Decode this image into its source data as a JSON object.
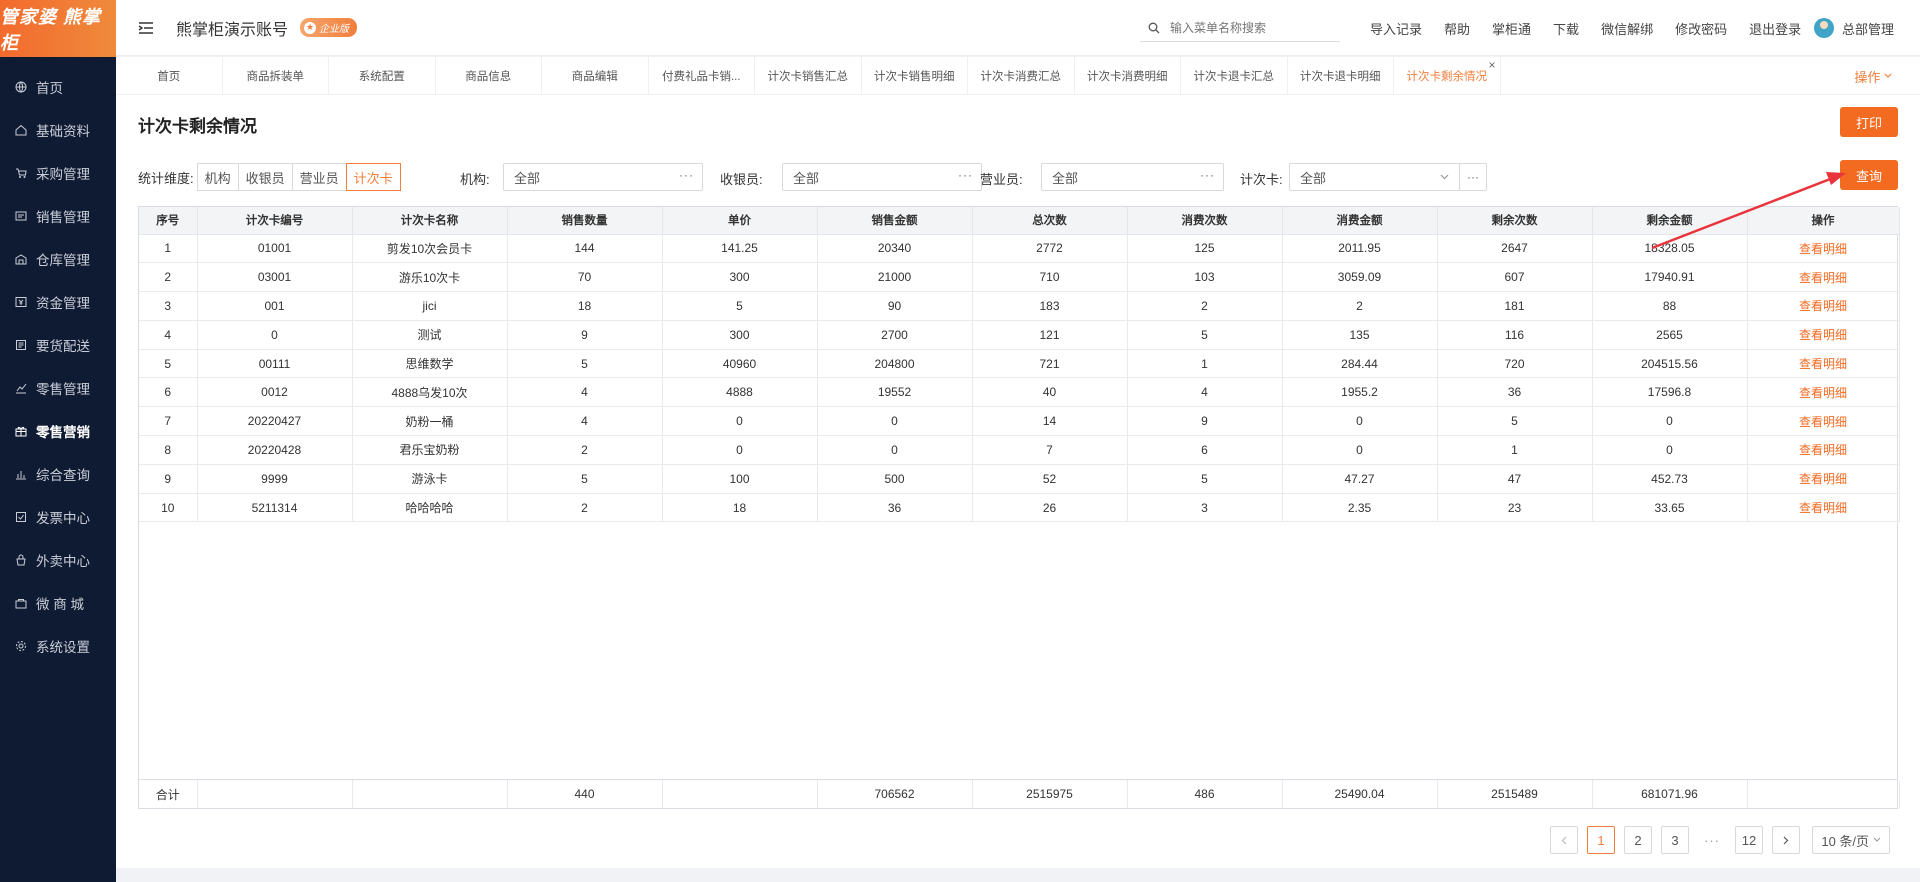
{
  "app": {
    "logo": "管家婆 熊掌柜",
    "account": "熊掌柜演示账号",
    "badge": "企业版"
  },
  "sidebar": {
    "items": [
      {
        "label": "首页",
        "icon": "globe-icon"
      },
      {
        "label": "基础资料",
        "icon": "home-icon"
      },
      {
        "label": "采购管理",
        "icon": "cart-icon"
      },
      {
        "label": "销售管理",
        "icon": "sale-icon"
      },
      {
        "label": "仓库管理",
        "icon": "warehouse-icon"
      },
      {
        "label": "资金管理",
        "icon": "money-icon"
      },
      {
        "label": "要货配送",
        "icon": "delivery-icon"
      },
      {
        "label": "零售管理",
        "icon": "chart-icon"
      },
      {
        "label": "零售营销",
        "icon": "gift-icon"
      },
      {
        "label": "综合查询",
        "icon": "bar-icon"
      },
      {
        "label": "发票中心",
        "icon": "invoice-icon"
      },
      {
        "label": "外卖中心",
        "icon": "takeout-icon"
      },
      {
        "label": "微 商 城",
        "icon": "shop-icon"
      },
      {
        "label": "系统设置",
        "icon": "gear-icon"
      }
    ]
  },
  "header": {
    "search_placeholder": "输入菜单名称搜索",
    "links": [
      "导入记录",
      "帮助",
      "掌柜通",
      "下载",
      "微信解绑",
      "修改密码",
      "退出登录"
    ],
    "user": "总部管理"
  },
  "tabs": {
    "items": [
      "首页",
      "商品拆装单",
      "系统配置",
      "商品信息",
      "商品编辑",
      "付费礼品卡销...",
      "计次卡销售汇总",
      "计次卡销售明细",
      "计次卡消费汇总",
      "计次卡消费明细",
      "计次卡退卡汇总",
      "计次卡退卡明细",
      "计次卡剩余情况"
    ],
    "ops": "操作"
  },
  "page": {
    "title": "计次卡剩余情况",
    "print": "打印",
    "query": "查询",
    "dimension_label": "统计维度:",
    "dimensions": [
      "机构",
      "收银员",
      "营业员",
      "计次卡"
    ],
    "org_label": "机构:",
    "org_value": "全部",
    "cashier_label": "收银员:",
    "cashier_value": "全部",
    "sales_label": "营业员:",
    "sales_value": "全部",
    "card_label": "计次卡:",
    "card_value": "全部"
  },
  "table": {
    "headers": [
      "序号",
      "计次卡编号",
      "计次卡名称",
      "销售数量",
      "单价",
      "销售金额",
      "总次数",
      "消费次数",
      "消费金额",
      "剩余次数",
      "剩余金额",
      "操作"
    ],
    "rows": [
      [
        "1",
        "01001",
        "剪发10次会员卡",
        "144",
        "141.25",
        "20340",
        "2772",
        "125",
        "2011.95",
        "2647",
        "18328.05",
        "查看明细"
      ],
      [
        "2",
        "03001",
        "游乐10次卡",
        "70",
        "300",
        "21000",
        "710",
        "103",
        "3059.09",
        "607",
        "17940.91",
        "查看明细"
      ],
      [
        "3",
        "001",
        "jici",
        "18",
        "5",
        "90",
        "183",
        "2",
        "2",
        "181",
        "88",
        "查看明细"
      ],
      [
        "4",
        "0",
        "测试",
        "9",
        "300",
        "2700",
        "121",
        "5",
        "135",
        "116",
        "2565",
        "查看明细"
      ],
      [
        "5",
        "00111",
        "思维数学",
        "5",
        "40960",
        "204800",
        "721",
        "1",
        "284.44",
        "720",
        "204515.56",
        "查看明细"
      ],
      [
        "6",
        "0012",
        "4888乌发10次",
        "4",
        "4888",
        "19552",
        "40",
        "4",
        "1955.2",
        "36",
        "17596.8",
        "查看明细"
      ],
      [
        "7",
        "20220427",
        "奶粉一桶",
        "4",
        "0",
        "0",
        "14",
        "9",
        "0",
        "5",
        "0",
        "查看明细"
      ],
      [
        "8",
        "20220428",
        "君乐宝奶粉",
        "2",
        "0",
        "0",
        "7",
        "6",
        "0",
        "1",
        "0",
        "查看明细"
      ],
      [
        "9",
        "9999",
        "游泳卡",
        "5",
        "100",
        "500",
        "52",
        "5",
        "47.27",
        "47",
        "452.73",
        "查看明细"
      ],
      [
        "10",
        "5211314",
        "哈哈哈哈",
        "2",
        "18",
        "36",
        "26",
        "3",
        "2.35",
        "23",
        "33.65",
        "查看明细"
      ]
    ],
    "total": [
      "合计",
      "",
      "",
      "440",
      "",
      "706562",
      "2515975",
      "486",
      "25490.04",
      "2515489",
      "681071.96",
      ""
    ]
  },
  "pager": {
    "pages": [
      "1",
      "2",
      "3",
      "12"
    ],
    "current": "1",
    "ellipsis": "···",
    "size": "10 条/页"
  },
  "colors": {
    "accent": "#f36a21",
    "sidebar": "#0f1b33"
  }
}
